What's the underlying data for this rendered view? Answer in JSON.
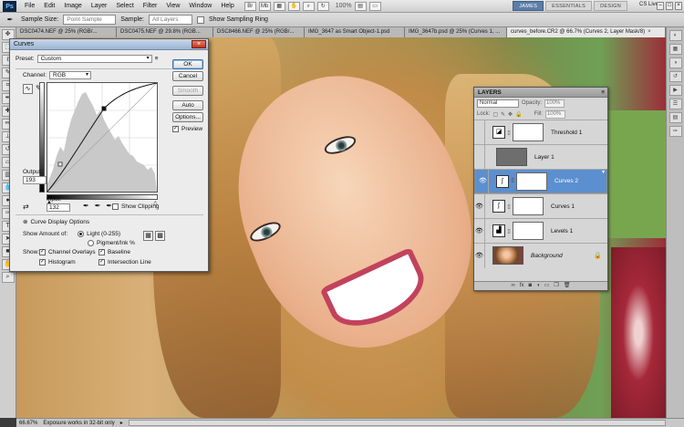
{
  "menubar": {
    "logo": "Ps",
    "items": [
      "File",
      "Edit",
      "Image",
      "Layer",
      "Select",
      "Filter",
      "View",
      "Window",
      "Help"
    ],
    "zoom": "100%",
    "workspaces": [
      "JAMES",
      "ESSENTIALS",
      "DESIGN"
    ],
    "active_workspace": "JAMES",
    "cs_live": "CS Live"
  },
  "options": {
    "sample_size_label": "Sample Size:",
    "sample_size_value": "Point Sample",
    "sample_label": "Sample:",
    "sample_value": "All Layers",
    "show_ring_label": "Show Sampling Ring"
  },
  "tabs": [
    {
      "label": "DSC0474.NEF @ 25% (RGB/..."
    },
    {
      "label": "DSC0475.NEF @ 29.8% (RGB..."
    },
    {
      "label": "DSC8466.NEF @ 25% (RGB/..."
    },
    {
      "label": "IMG_3647 as Smart Object-1.psd"
    },
    {
      "label": "IMG_3647b.psd @ 25% (Curves 1, ..."
    },
    {
      "label": "curves_before.CR2 @ 66.7% (Curves 2, Layer Mask/8)"
    }
  ],
  "status": {
    "zoom": "66.67%",
    "info": "Exposure works in 32-bit only"
  },
  "curves": {
    "title": "Curves",
    "preset_label": "Preset:",
    "preset_value": "Custom",
    "channel_label": "Channel:",
    "channel_value": "RGB",
    "ok": "OK",
    "cancel": "Cancel",
    "smooth": "Smooth",
    "auto": "Auto",
    "options": "Options...",
    "preview": "Preview",
    "output_label": "Output:",
    "output_value": "193",
    "input_label": "Input:",
    "input_value": "132",
    "show_clipping": "Show Clipping",
    "display_options": "Curve Display Options",
    "show_amount_label": "Show Amount of:",
    "light_label": "Light (0-255)",
    "pigment_label": "Pigment/Ink %",
    "show_label": "Show:",
    "channel_overlays": "Channel Overlays",
    "baseline": "Baseline",
    "histogram": "Histogram",
    "intersection_line": "Intersection Line"
  },
  "layers": {
    "title": "LAYERS",
    "blend_mode": "Normal",
    "opacity_label": "Opacity:",
    "opacity_value": "100%",
    "lock_label": "Lock:",
    "fill_label": "Fill:",
    "fill_value": "100%",
    "items": [
      {
        "name": "Threshold 1",
        "selected": false
      },
      {
        "name": "Layer 1",
        "selected": false
      },
      {
        "name": "Curves 2",
        "selected": true
      },
      {
        "name": "Curves 1",
        "selected": false
      },
      {
        "name": "Levels 1",
        "selected": false
      },
      {
        "name": "Background",
        "selected": false
      }
    ],
    "footer_icons": [
      "link-icon",
      "fx-icon",
      "mask-icon",
      "adjustment-icon",
      "folder-icon",
      "new-layer-icon",
      "trash-icon"
    ]
  }
}
